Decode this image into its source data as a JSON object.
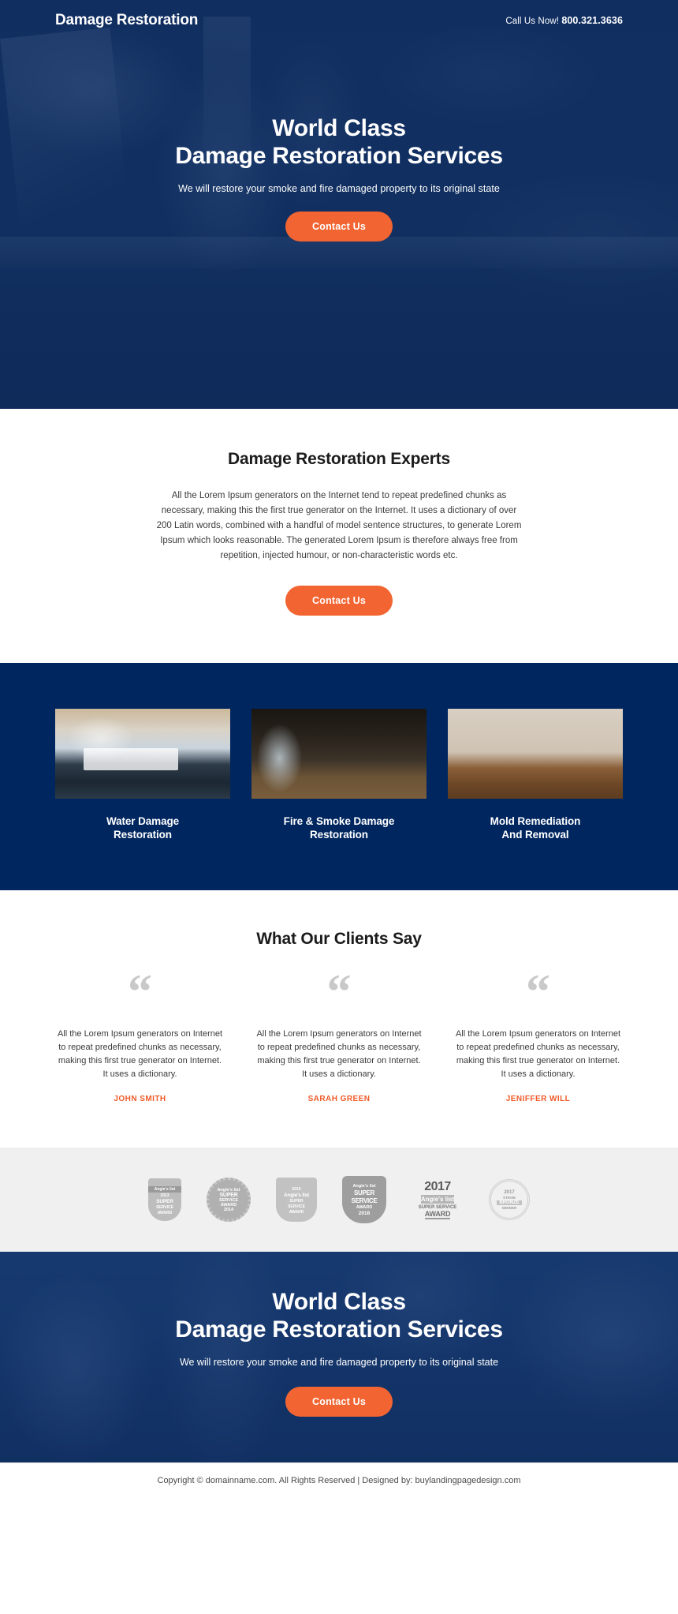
{
  "colors": {
    "navy": "#00265f",
    "hero_navy": "#112f61",
    "orange": "#f26532",
    "badge_bg": "#f0f0f0",
    "name_orange": "#f05a28"
  },
  "header": {
    "logo": "Damage Restoration",
    "call_label": "Call Us Now!",
    "phone": "800.321.3636"
  },
  "hero": {
    "title_line1": "World Class",
    "title_line2": "Damage Restoration Services",
    "subtitle": "We will restore your smoke and fire damaged property to its original state",
    "cta_label": "Contact Us"
  },
  "experts": {
    "title": "Damage Restoration Experts",
    "paragraph": "All the Lorem Ipsum generators on the Internet tend to repeat predefined chunks as necessary, making this the first true generator on the Internet. It uses a dictionary of over 200 Latin words, combined with a handful of model sentence structures, to generate Lorem Ipsum which looks reasonable. The generated Lorem Ipsum is therefore always free from repetition, injected humour, or non-characteristic words etc.",
    "cta_label": "Contact Us"
  },
  "services": {
    "items": [
      {
        "title_line1": "Water Damage",
        "title_line2": "Restoration",
        "image_alt": "flooded-kitchen-photo"
      },
      {
        "title_line1": "Fire & Smoke Damage",
        "title_line2": "Restoration",
        "image_alt": "burnt-kitchen-photo"
      },
      {
        "title_line1": "Mold Remediation",
        "title_line2": "And Removal",
        "image_alt": "mold-wall-photo"
      }
    ]
  },
  "testimonials": {
    "title": "What Our Clients Say",
    "quote_glyph": "“",
    "items": [
      {
        "text": "All the Lorem Ipsum generators on Internet to repeat predefined chunks as necessary, making this first true generator on Internet. It uses a dictionary.",
        "name": "JOHN SMITH"
      },
      {
        "text": "All the Lorem Ipsum generators on Internet to repeat predefined chunks as necessary, making this first true generator on Internet. It uses a dictionary.",
        "name": "SARAH GREEN"
      },
      {
        "text": "All the Lorem Ipsum generators on Internet to repeat predefined chunks as necessary, making this first true generator on Internet. It uses a dictionary.",
        "name": "JENIFFER WILL"
      }
    ]
  },
  "badges": {
    "items": [
      {
        "brand": "Angie's list",
        "year": "2013",
        "line1": "SUPER",
        "line2": "SERVICE",
        "line3": "AWARD"
      },
      {
        "brand": "Angie's list",
        "year": "2014",
        "line1": "SUPER",
        "line2": "SERVICE",
        "line3": "AWARD"
      },
      {
        "brand": "Angie's list",
        "year": "2015",
        "line1": "SUPER",
        "line2": "SERVICE",
        "line3": "AWARD"
      },
      {
        "brand": "Angie's list",
        "year": "2016",
        "line1": "SUPER",
        "line2": "SERVICE",
        "line3": "AWARD"
      },
      {
        "brand": "Angie's list",
        "year": "2017",
        "line1": "SUPER SERVICE",
        "line2": "AWARD",
        "line3": ""
      },
      {
        "brand": "STEVIE",
        "year": "2017",
        "line1": "BRONZE",
        "line2": "WINNER",
        "line3": "AMERICAN BUSINESS AWARDS"
      }
    ]
  },
  "bottom_cta": {
    "title_line1": "World Class",
    "title_line2": "Damage Restoration Services",
    "subtitle": "We will restore your smoke and fire damaged property to its original state",
    "cta_label": "Contact Us"
  },
  "footer": {
    "text": "Copyright © domainname.com. All Rights Reserved | Designed by: buylandingpagedesign.com"
  }
}
